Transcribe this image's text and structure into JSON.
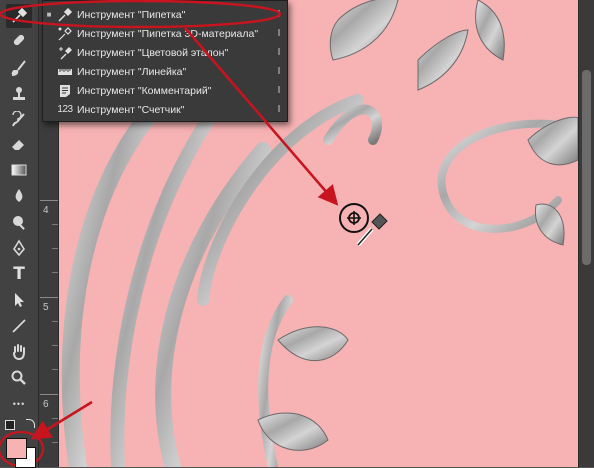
{
  "flyout_menu": {
    "items": [
      {
        "label": "Инструмент \"Пипетка\"",
        "shortcut": "I",
        "icon": "eyedropper-icon",
        "active": true
      },
      {
        "label": "Инструмент \"Пипетка 3D-материала\"",
        "shortcut": "I",
        "icon": "3d-material-eyedropper-icon",
        "active": false
      },
      {
        "label": "Инструмент \"Цветовой эталон\"",
        "shortcut": "I",
        "icon": "color-sampler-icon",
        "active": false
      },
      {
        "label": "Инструмент \"Линейка\"",
        "shortcut": "I",
        "icon": "ruler-icon",
        "active": false
      },
      {
        "label": "Инструмент \"Комментарий\"",
        "shortcut": "I",
        "icon": "note-icon",
        "active": false
      },
      {
        "label": "Инструмент \"Счетчик\"",
        "shortcut": "I",
        "icon": "count-icon",
        "active": false
      }
    ]
  },
  "count_icon_glyph": "123",
  "ruler": {
    "labels": [
      "4",
      "5",
      "6"
    ]
  },
  "toolbar": {
    "tools": [
      "eyedropper-icon",
      "healing-brush-icon",
      "brush-icon",
      "clone-stamp-icon",
      "history-brush-icon",
      "eraser-icon",
      "gradient-icon",
      "blur-icon",
      "dodge-icon",
      "pen-icon",
      "type-icon",
      "path-selection-icon",
      "line-icon",
      "hand-icon",
      "zoom-icon",
      "more-icon"
    ],
    "type_glyph": "T",
    "more_glyph": "•••"
  },
  "colors": {
    "foreground": "#f7b2b3",
    "background": "#ffffff",
    "canvas": "#f7b2b3",
    "annotation": "#c8141e"
  }
}
